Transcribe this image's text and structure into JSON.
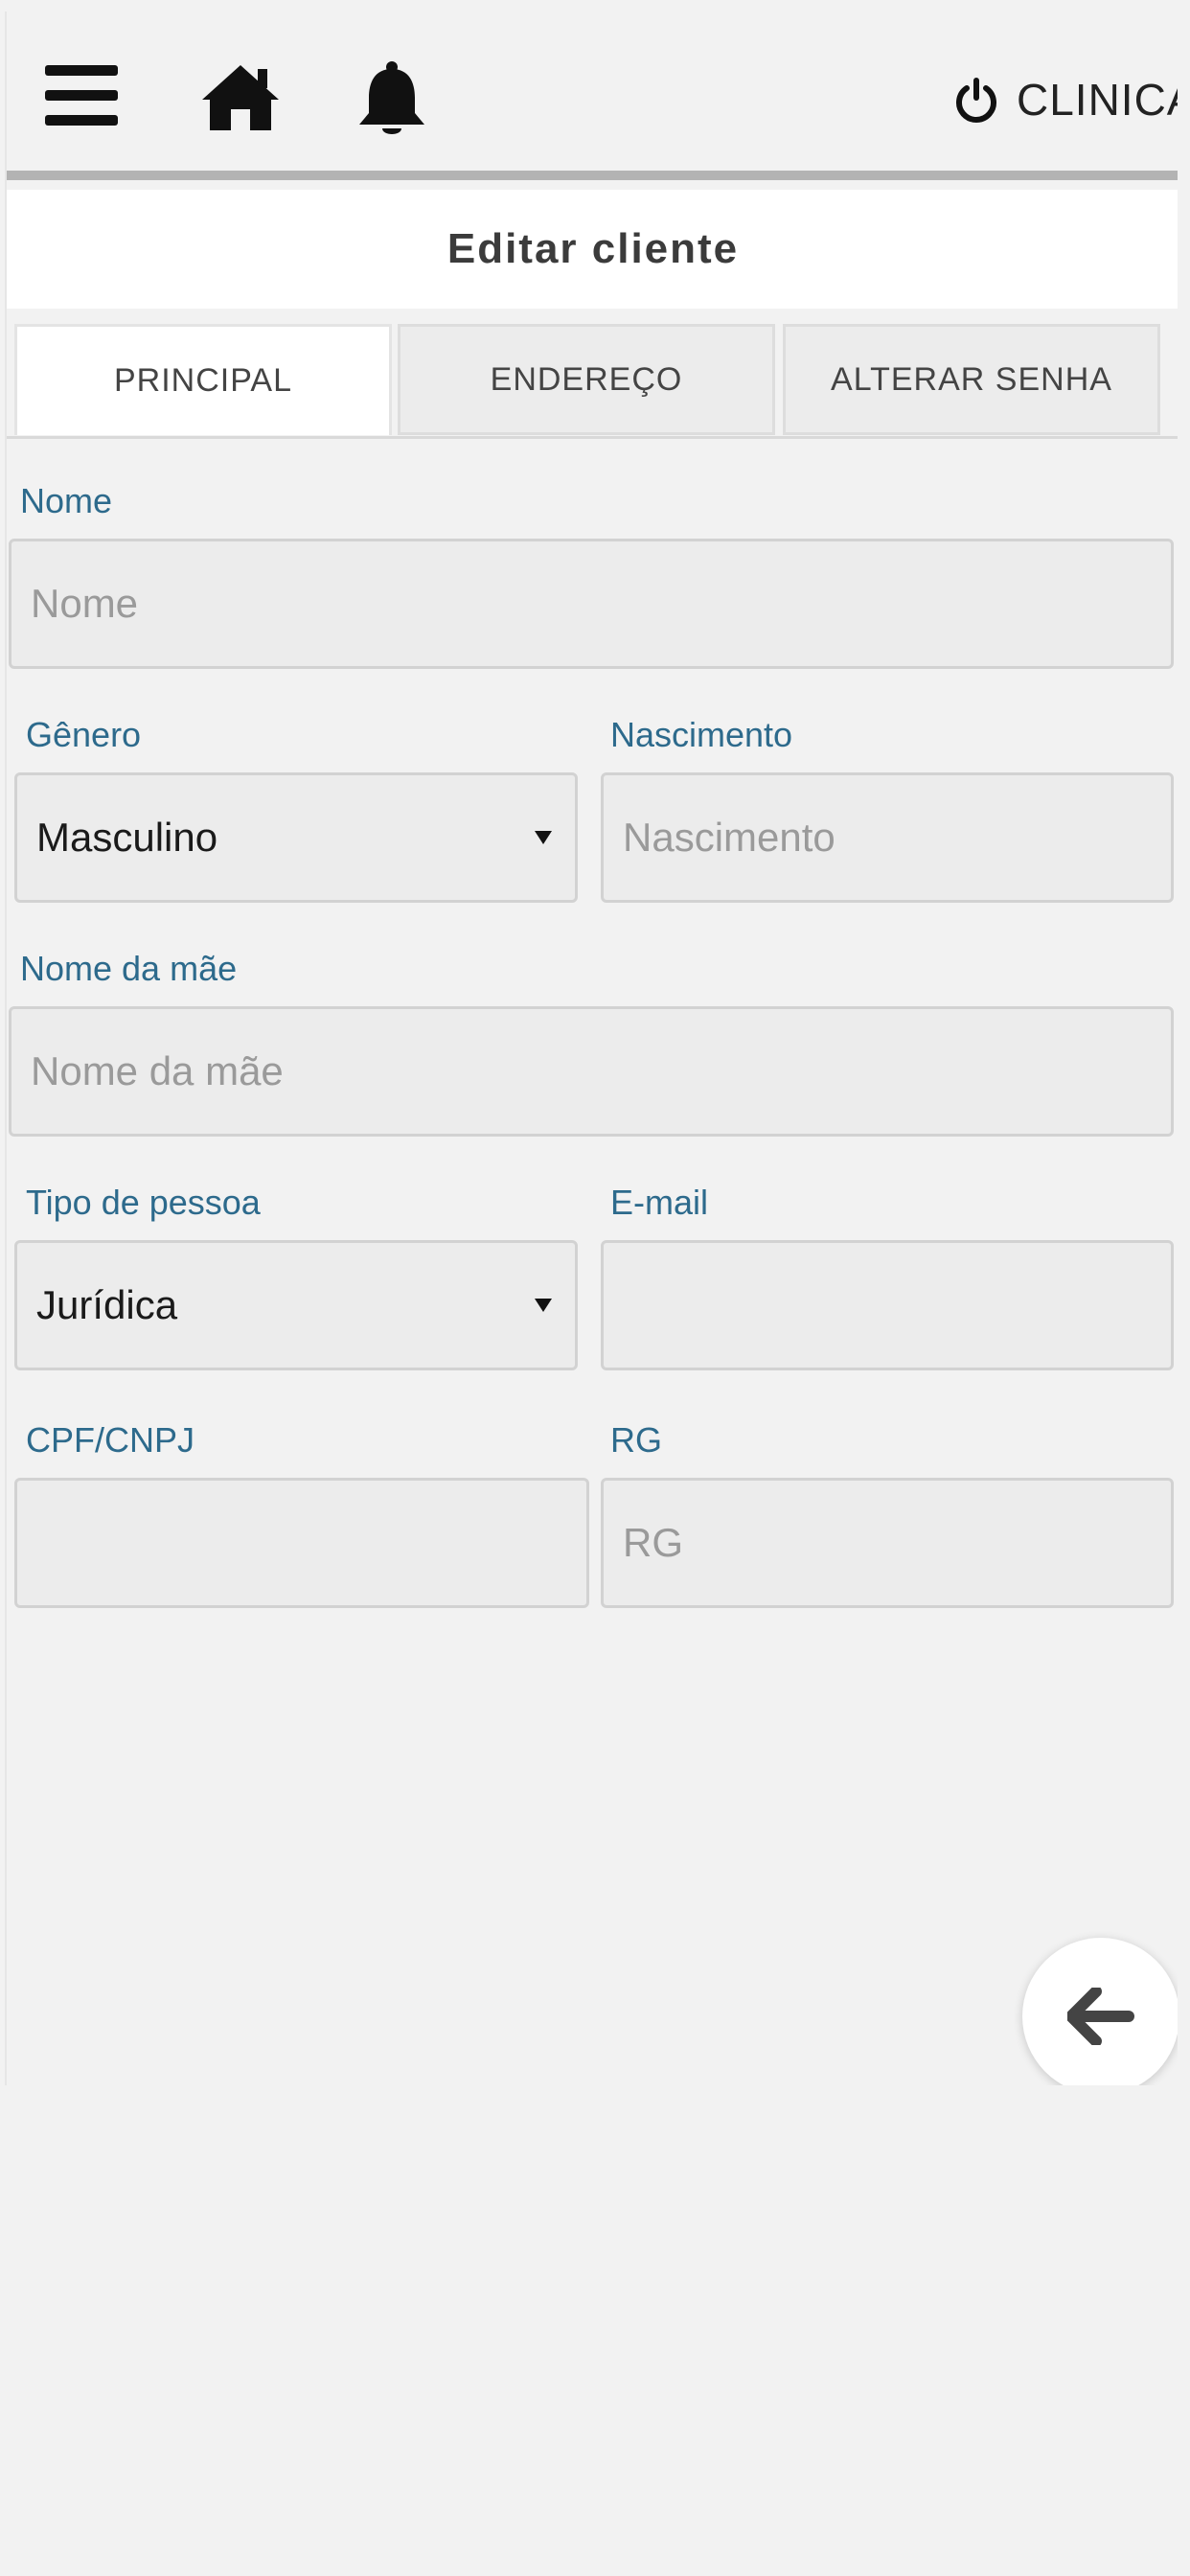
{
  "header": {
    "menu_icon": "menu-icon",
    "home_icon": "home-icon",
    "bell_icon": "bell-icon",
    "power_icon": "power-icon",
    "logout_label": "CLINICA"
  },
  "page": {
    "title": "Editar cliente"
  },
  "tabs": [
    {
      "label": "PRINCIPAL",
      "active": true
    },
    {
      "label": "ENDEREÇO",
      "active": false
    },
    {
      "label": "ALTERAR SENHA",
      "active": false
    }
  ],
  "form": {
    "nome": {
      "label": "Nome",
      "placeholder": "Nome",
      "value": ""
    },
    "genero": {
      "label": "Gênero",
      "value": "Masculino"
    },
    "nascimento": {
      "label": "Nascimento",
      "placeholder": "Nascimento",
      "value": ""
    },
    "nome_mae": {
      "label": "Nome da mãe",
      "placeholder": "Nome da mãe",
      "value": ""
    },
    "tipo_pessoa": {
      "label": "Tipo de pessoa",
      "value": "Jurídica"
    },
    "email": {
      "label": "E-mail",
      "placeholder": "",
      "value": ""
    },
    "cpf_cnpj": {
      "label": "CPF/CNPJ",
      "placeholder": "",
      "value": ""
    },
    "rg": {
      "label": "RG",
      "placeholder": "RG",
      "value": ""
    }
  },
  "actions": {
    "back_icon": "arrow-left-icon"
  },
  "colors": {
    "background": "#f2f2f2",
    "label": "#2d6a8c",
    "field": "#ececec",
    "title": "#3b3b3b"
  }
}
